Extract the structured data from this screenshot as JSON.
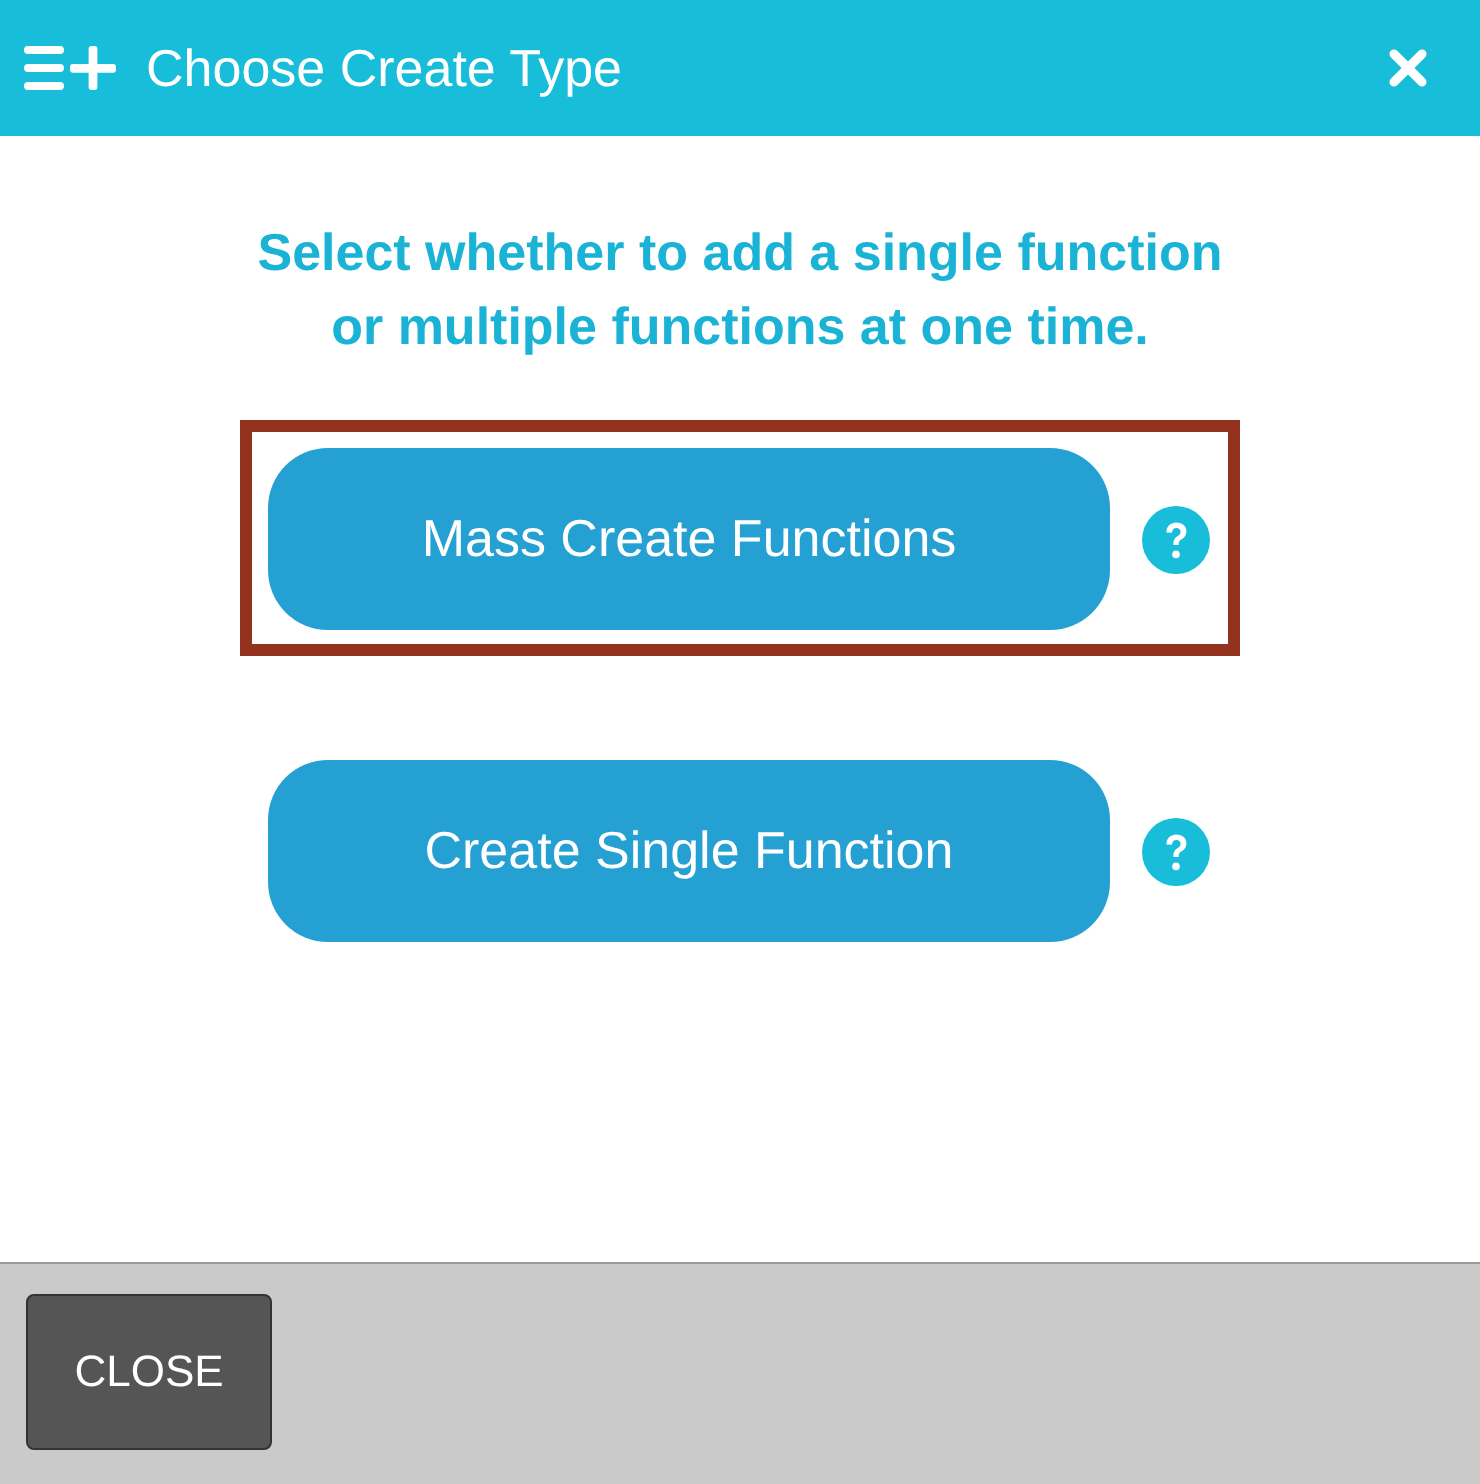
{
  "dialog": {
    "title": "Choose Create Type",
    "prompt": "Select whether to add a single function or multiple functions at one time.",
    "options": [
      {
        "label": "Mass Create Functions",
        "highlighted": true
      },
      {
        "label": "Create Single Function",
        "highlighted": false
      }
    ],
    "footer": {
      "buttons": [
        "CLOSE"
      ]
    }
  }
}
